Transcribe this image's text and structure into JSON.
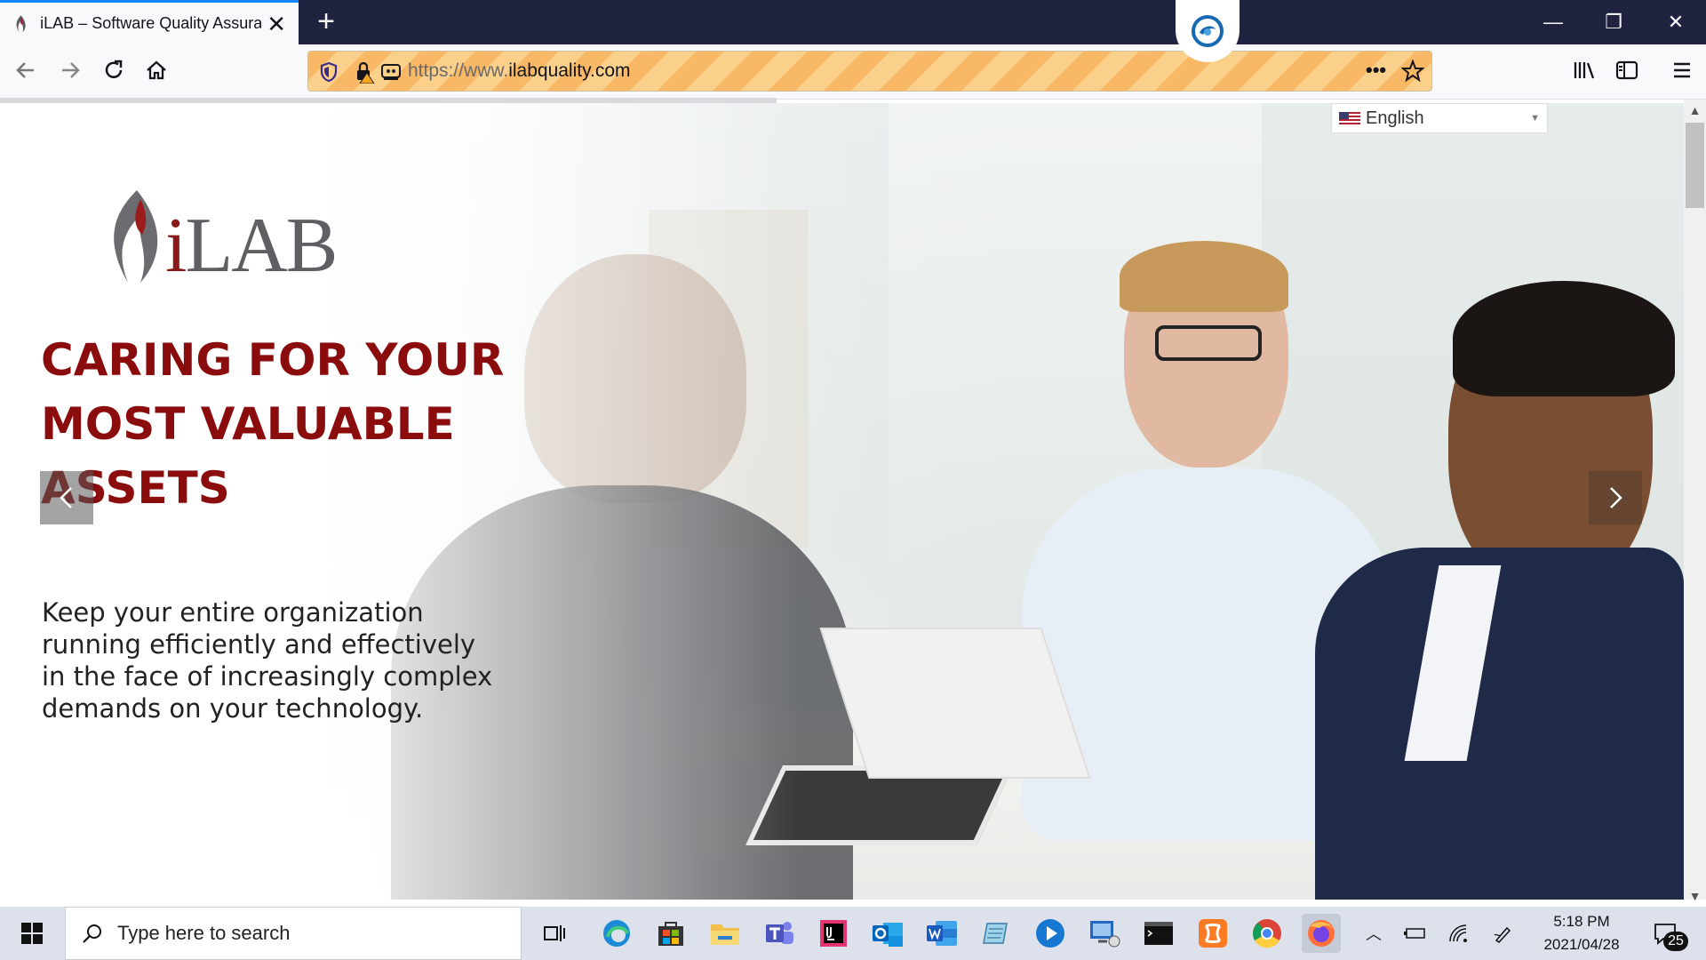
{
  "browser": {
    "tab_title": "iLAB – Software Quality Assurance",
    "url_prefix": "https://www.",
    "url_domain": "ilabquality.com",
    "page_actions_label": "•••"
  },
  "page": {
    "language_selector": "English",
    "logo_text_i": "i",
    "logo_text_rest": "LAB",
    "headline": "CARING FOR YOUR MOST VALUABLE ASSETS",
    "subheading": "Keep your entire organization running efficiently and effectively in the face of increasingly complex demands on your technology.",
    "accent_color": "#8b0c0c"
  },
  "taskbar": {
    "search_placeholder": "Type here to search",
    "time": "5:18 PM",
    "date": "2021/04/28",
    "notification_count": "25",
    "pinned_apps": [
      "task-view-icon",
      "edge-icon",
      "store-icon",
      "file-explorer-icon",
      "teams-icon",
      "intellij-icon",
      "outlook-icon",
      "word-icon",
      "notepad-icon",
      "media-player-icon",
      "remote-desktop-icon",
      "terminal-icon",
      "xampp-icon",
      "chrome-icon",
      "firefox-icon"
    ]
  }
}
